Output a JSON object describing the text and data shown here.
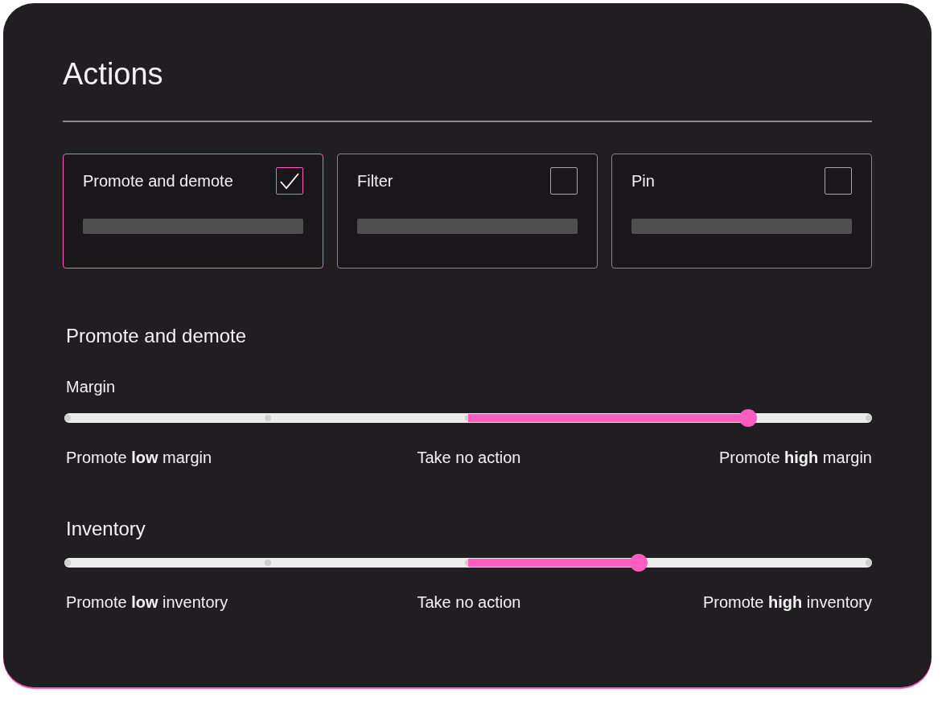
{
  "title": "Actions",
  "options": [
    {
      "label": "Promote and demote",
      "checked": true
    },
    {
      "label": "Filter",
      "checked": false
    },
    {
      "label": "Pin",
      "checked": false
    }
  ],
  "section_title": "Promote and demote",
  "sliders": [
    {
      "label": "Margin",
      "level": 0.847,
      "left": "Promote **low** margin",
      "middle": "Take no action",
      "right": "Promote **high** margin"
    },
    {
      "label": "Inventory",
      "level": 0.711,
      "left": "Promote **low** inventory",
      "middle": "Take no action",
      "right": "Promote **high** inventory"
    }
  ]
}
